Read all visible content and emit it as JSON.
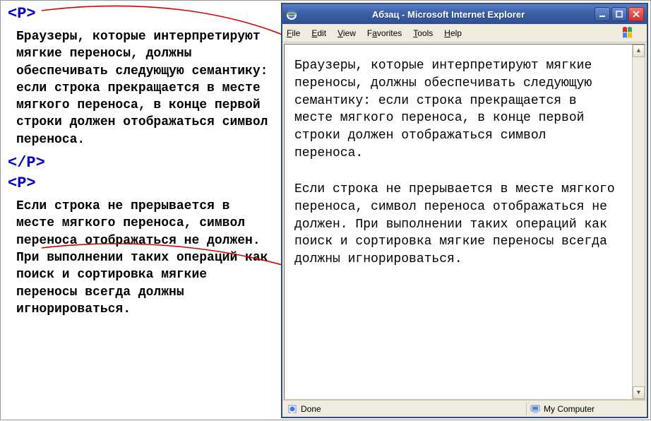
{
  "left": {
    "tag_open": "<P>",
    "tag_close": "</P>",
    "para1": "Браузеры, которые интерпретируют мягкие переносы, должны обеспечивать следующую семантику: если строка прекращается в месте мягкого переноса, в конце первой строки должен отображаться символ переноса.",
    "para2": "Если строка не прерывается в месте мягкого переноса, символ переноса отображаться не должен. При выполнении таких операций как поиск и сортировка мягкие переносы всегда должны игнорироваться."
  },
  "browser": {
    "title": "Абзац - Microsoft Internet Explorer",
    "menus": {
      "file": "File",
      "edit": "Edit",
      "view": "View",
      "favorites": "Favorites",
      "tools": "Tools",
      "help": "Help"
    },
    "content": {
      "p1": "Браузеры, которые интерпретируют мягкие переносы, должны обеспечивать следующую семантику: если строка прекращается в месте мягкого переноса, в конце первой строки должен отображаться символ переноса.",
      "p2": "Если строка не прерывается в месте мягкого переноса, символ переноса отображаться не должен. При выполнении таких операций как поиск и сортировка мягкие переносы всегда должны игнорироваться."
    },
    "status": {
      "done": "Done",
      "zone": "My Computer"
    }
  }
}
